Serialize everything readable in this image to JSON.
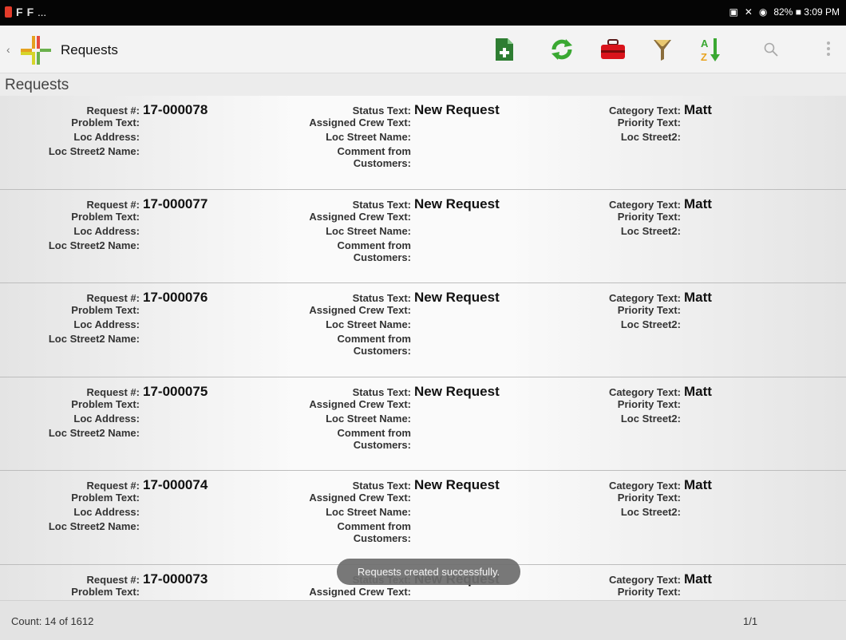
{
  "status_bar": {
    "left_dots": "...",
    "right_text": "82% ■ 3:09 PM"
  },
  "app_bar": {
    "title": "Requests"
  },
  "section_title": "Requests",
  "labels": {
    "request_no": "Request #:",
    "problem": "Problem Text:",
    "loc_address": "Loc Address:",
    "loc_street2_name": "Loc Street2 Name:",
    "status": "Status Text:",
    "assigned_crew": "Assigned Crew Text:",
    "loc_street_name": "Loc Street Name:",
    "comment_line1": "Comment from",
    "comment_line2": "Customers:",
    "category": "Category Text:",
    "priority": "Priority Text:",
    "loc_street2": "Loc Street2:"
  },
  "records": [
    {
      "request_no": "17-000078",
      "status": "New Request",
      "category": "Matt"
    },
    {
      "request_no": "17-000077",
      "status": "New Request",
      "category": "Matt"
    },
    {
      "request_no": "17-000076",
      "status": "New Request",
      "category": "Matt"
    },
    {
      "request_no": "17-000075",
      "status": "New Request",
      "category": "Matt"
    },
    {
      "request_no": "17-000074",
      "status": "New Request",
      "category": "Matt"
    },
    {
      "request_no": "17-000073",
      "status": "New Request",
      "category": "Matt"
    }
  ],
  "footer": {
    "count": "Count: 14 of 1612",
    "page": "1/1"
  },
  "toast": "Requests created successfully.",
  "icons": [
    "new-document-icon",
    "refresh-icon",
    "toolbox-icon",
    "filter-icon",
    "sort-az-icon",
    "search-icon",
    "overflow-menu-icon"
  ]
}
